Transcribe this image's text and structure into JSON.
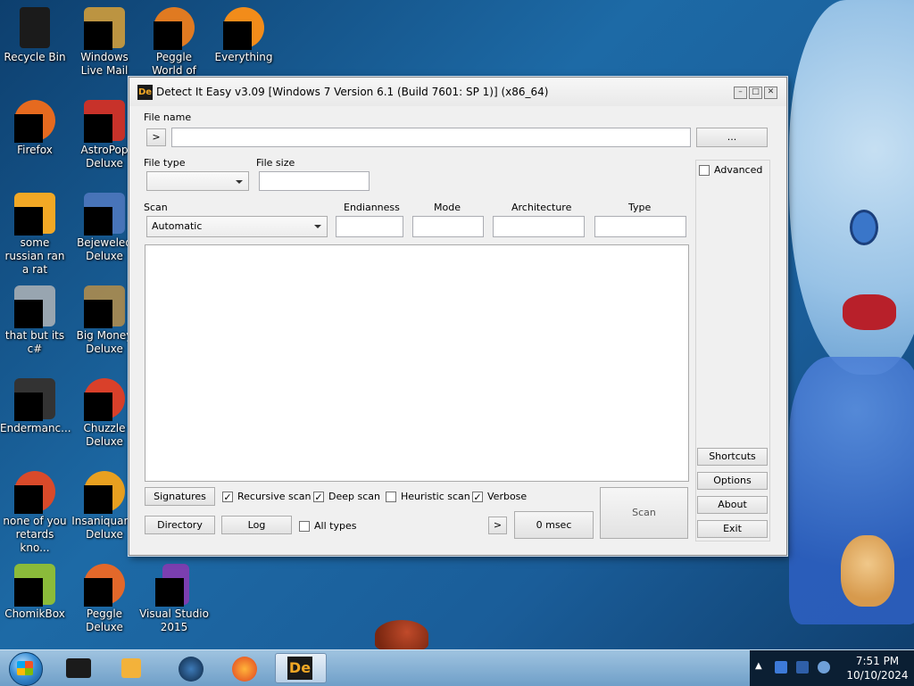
{
  "desktop": {
    "icons": [
      {
        "label": "Recycle Bin",
        "name": "recycle-bin"
      },
      {
        "label": "Windows Live Mail",
        "name": "windows-live-mail"
      },
      {
        "label": "Peggle World of Warcraft ...",
        "name": "peggle-wow"
      },
      {
        "label": "Everything",
        "name": "everything"
      },
      {
        "label": "Firefox",
        "name": "firefox"
      },
      {
        "label": "AstroPop Deluxe",
        "name": "astropop-deluxe"
      },
      {
        "label": "some russian ran a rat",
        "name": "some-russian-ran-a-rat"
      },
      {
        "label": "Bejeweled Deluxe",
        "name": "bejeweled-deluxe"
      },
      {
        "label": "that but its c#",
        "name": "that-but-its-csharp"
      },
      {
        "label": "Big Money Deluxe",
        "name": "big-money-deluxe"
      },
      {
        "label": "Endermanc...",
        "name": "endermanch"
      },
      {
        "label": "Chuzzle Deluxe",
        "name": "chuzzle-deluxe"
      },
      {
        "label": "none of you retards kno...",
        "name": "none-of-you"
      },
      {
        "label": "Insaniquar... Deluxe",
        "name": "insaniquarium-deluxe"
      },
      {
        "label": "ChomikBox",
        "name": "chomikbox"
      },
      {
        "label": "Peggle Deluxe",
        "name": "peggle-deluxe"
      },
      {
        "label": "Visual Studio 2015",
        "name": "visual-studio-2015"
      }
    ],
    "icon_colors": [
      "#1b1b1b",
      "#e7a733",
      "#e07a21",
      "#f28c1a",
      "#e66a1f",
      "#c8322a",
      "#f2a825",
      "#6a8ad8",
      "#b9b9b9",
      "#d89a3a",
      "#333333",
      "#d9402a",
      "#d94a2a",
      "#e8a020",
      "#8bbb3a",
      "#e3682a",
      "#7b3fb0"
    ]
  },
  "window": {
    "title": "Detect It Easy v3.09 [Windows 7 Version 6.1 (Build 7601: SP 1)] (x86_64)",
    "icon_text": "De",
    "controls": {
      "minimize": "–",
      "maximize": "□",
      "close": "✕"
    },
    "file_name_label": "File name",
    "file_name_arrow": ">",
    "file_name_value": "",
    "browse_label": "...",
    "file_type_label": "File type",
    "file_type_value": "",
    "file_size_label": "File size",
    "file_size_value": "",
    "scan_label": "Scan",
    "scan_value": "Automatic",
    "endianness_label": "Endianness",
    "mode_label": "Mode",
    "architecture_label": "Architecture",
    "type_label": "Type",
    "advanced_label": "Advanced",
    "signatures_label": "Signatures",
    "recursive_scan_label": "Recursive scan",
    "deep_scan_label": "Deep scan",
    "heuristic_scan_label": "Heuristic scan",
    "verbose_label": "Verbose",
    "directory_label": "Directory",
    "log_label": "Log",
    "all_types_label": "All types",
    "next_arrow": ">",
    "time_label": "0 msec",
    "scan_button_label": "Scan",
    "shortcuts_label": "Shortcuts",
    "options_label": "Options",
    "about_label": "About",
    "exit_label": "Exit"
  },
  "taskbar": {
    "time": "7:51 PM",
    "date": "10/10/2024",
    "items": [
      "terminal",
      "media-player",
      "security-center",
      "firefox",
      "detect-it-easy"
    ],
    "tray_arrow": "▲"
  }
}
